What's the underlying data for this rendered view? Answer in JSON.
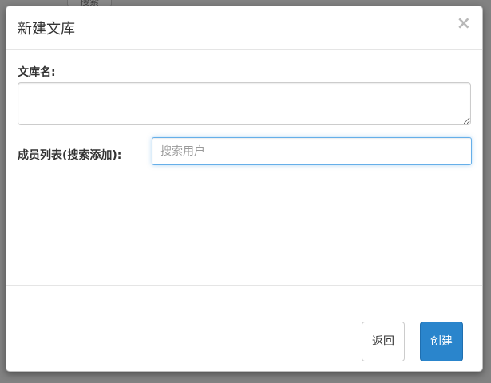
{
  "background": {
    "partial_button_label": "搜索"
  },
  "modal": {
    "title": "新建文库",
    "close_symbol": "×",
    "library_name_label": "文库名:",
    "library_name_value": "",
    "members_label": "成员列表(搜索添加):",
    "search_placeholder": "搜索用户",
    "search_value": "",
    "back_button_label": "返回",
    "create_button_label": "创建"
  },
  "colors": {
    "overlay": "#828282",
    "primary_button": "#2a85cc",
    "focus_border": "#66afe9"
  }
}
